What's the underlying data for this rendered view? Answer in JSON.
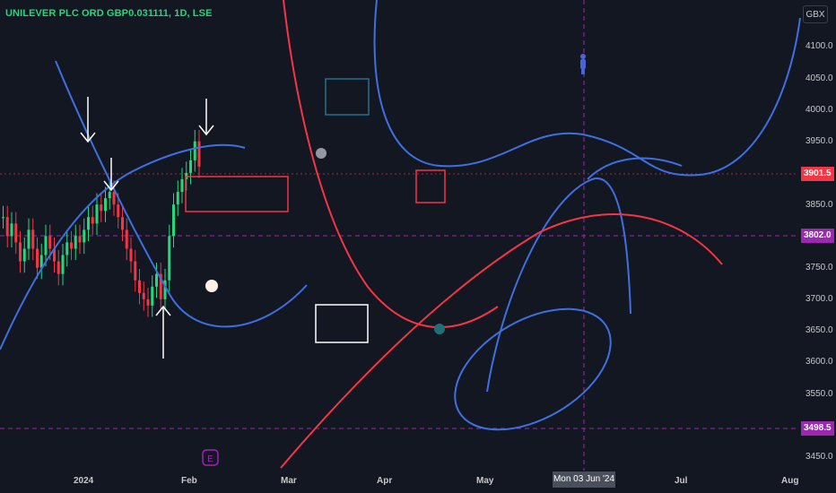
{
  "header": {
    "symbol_title": "UNILEVER PLC ORD GBP0.031111, 1D, LSE",
    "currency_label": "GBX"
  },
  "price_axis": {
    "ticks": [
      "4100.0",
      "4050.0",
      "4000.0",
      "3950.0",
      "3850.0",
      "3750.0",
      "3700.0",
      "3650.0",
      "3600.0",
      "3550.0",
      "3450.0"
    ],
    "tags": {
      "last_price": {
        "value": "3901.5",
        "color": "#f23645"
      },
      "crosshair_price": {
        "value": "3802.0",
        "color": "#9c27b0"
      },
      "level_price": {
        "value": "3498.5",
        "color": "#9c27b0"
      }
    }
  },
  "time_axis": {
    "ticks": [
      "2024",
      "Feb",
      "Mar",
      "Apr",
      "May",
      "Jul",
      "Aug"
    ],
    "crosshair_date": "Mon 03 Jun '24"
  },
  "markers": {
    "earnings_label": "E"
  },
  "colors": {
    "background": "#131722",
    "up_candle": "#26d67a",
    "down_candle": "#f23645",
    "blue_curves": "#3f6fe0",
    "red_curves": "#f23645",
    "crosshair": "#9c27b0"
  },
  "chart_data": {
    "type": "candlestick",
    "title": "UNILEVER PLC ORD GBP0.031111, 1D, LSE",
    "currency": "GBX",
    "ylim": [
      3440,
      4130
    ],
    "y_ticks": [
      3450,
      3550,
      3600,
      3650,
      3700,
      3750,
      3850,
      3950,
      4000,
      4050,
      4100
    ],
    "x_ticks": [
      "2024",
      "Feb",
      "Mar",
      "Apr",
      "May",
      "Jul",
      "Aug"
    ],
    "last_price": 3901.5,
    "crosshair": {
      "price": 3802.0,
      "date": "Mon 03 Jun '24"
    },
    "horizontal_level": 3498.5,
    "candles_close": [
      3830,
      3800,
      3820,
      3790,
      3760,
      3780,
      3810,
      3780,
      3750,
      3770,
      3800,
      3780,
      3760,
      3740,
      3770,
      3790,
      3780,
      3800,
      3790,
      3810,
      3830,
      3820,
      3850,
      3840,
      3860,
      3870,
      3850,
      3830,
      3810,
      3780,
      3760,
      3730,
      3710,
      3700,
      3690,
      3720,
      3740,
      3700,
      3730,
      3800,
      3850,
      3870,
      3890,
      3900,
      3920,
      3950,
      3910
    ]
  }
}
